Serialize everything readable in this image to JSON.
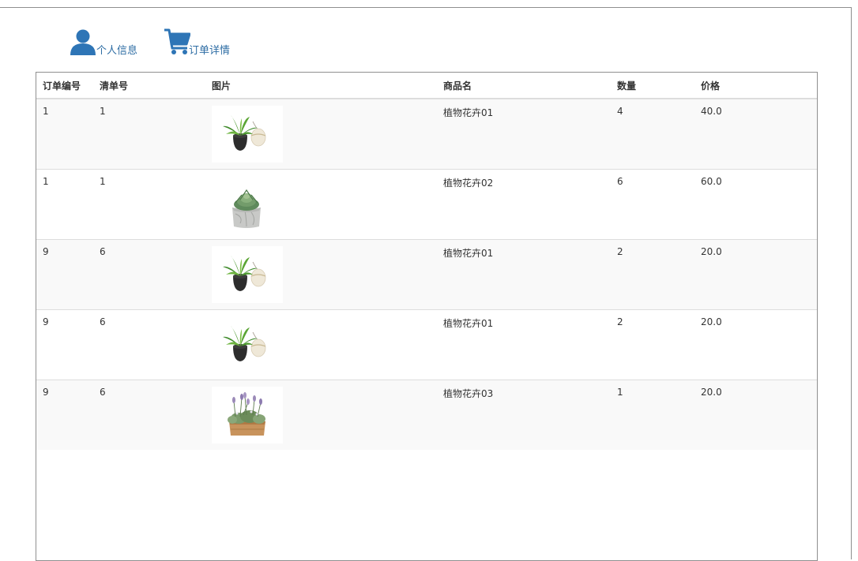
{
  "nav": {
    "profile": {
      "label": "个人信息",
      "icon": "user-icon"
    },
    "orders": {
      "label": "订单详情",
      "icon": "shopping-cart-icon"
    }
  },
  "colors": {
    "link": "#2e6da4",
    "icon": "#2e75b6",
    "stripe": "#f9f9f9"
  },
  "table": {
    "headers": {
      "order_id": "订单编号",
      "list_no": "清单号",
      "image": "图片",
      "product_name": "商品名",
      "quantity": "数量",
      "price": "价格"
    },
    "rows": [
      {
        "order_id": "1",
        "list_no": "1",
        "image": "plant-pot-pair",
        "product_name": "植物花卉01",
        "quantity": "4",
        "price": "40.0"
      },
      {
        "order_id": "1",
        "list_no": "1",
        "image": "succulent-bag",
        "product_name": "植物花卉02",
        "quantity": "6",
        "price": "60.0"
      },
      {
        "order_id": "9",
        "list_no": "6",
        "image": "plant-pot-pair",
        "product_name": "植物花卉01",
        "quantity": "2",
        "price": "20.0"
      },
      {
        "order_id": "9",
        "list_no": "6",
        "image": "plant-pot-pair",
        "product_name": "植物花卉01",
        "quantity": "2",
        "price": "20.0"
      },
      {
        "order_id": "9",
        "list_no": "6",
        "image": "lavender-box",
        "product_name": "植物花卉03",
        "quantity": "1",
        "price": "20.0"
      }
    ]
  }
}
